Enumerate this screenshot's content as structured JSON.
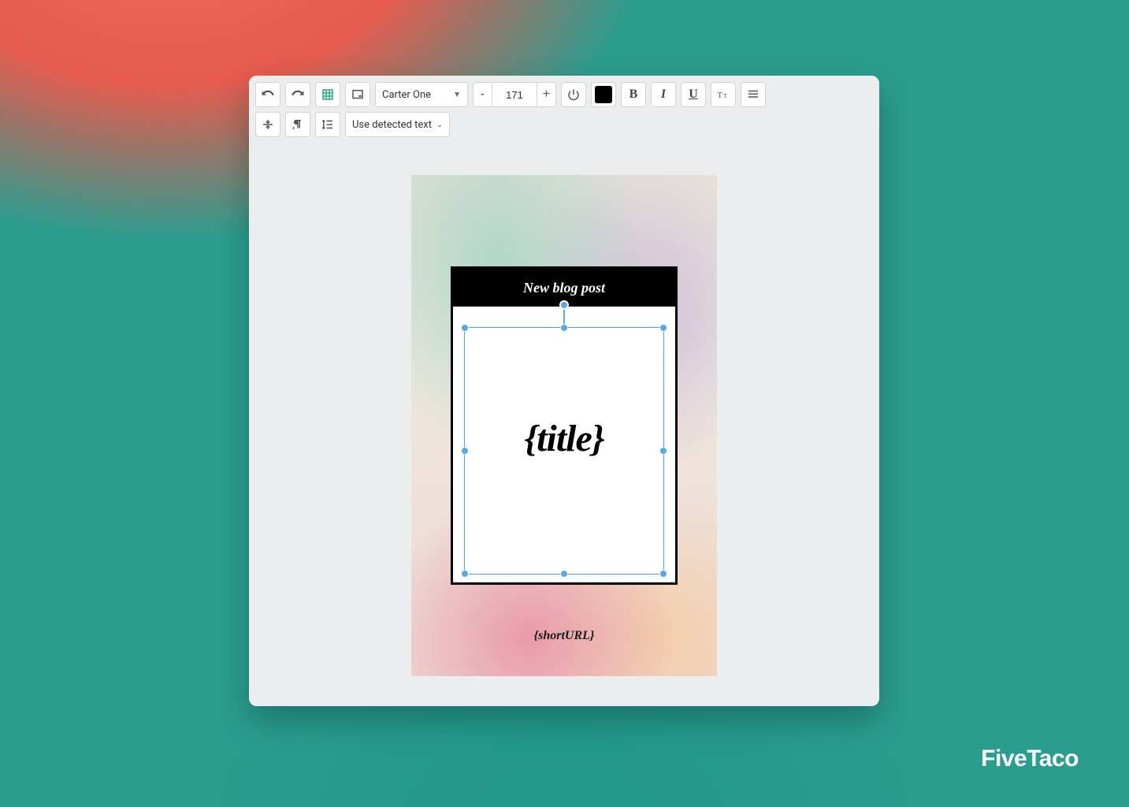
{
  "brand": "FiveTaco",
  "toolbar": {
    "font_name": "Carter One",
    "font_size": "171",
    "minus_label": "-",
    "plus_label": "+",
    "bold_label": "B",
    "italic_label": "I",
    "underline_label": "U",
    "detected_text_label": "Use detected text",
    "text_color": "#000000"
  },
  "canvas": {
    "header_text": "New blog post",
    "title_placeholder": "{title}",
    "shorturl_placeholder": "{shortURL}"
  },
  "colors": {
    "selection": "#5aa9e6"
  }
}
